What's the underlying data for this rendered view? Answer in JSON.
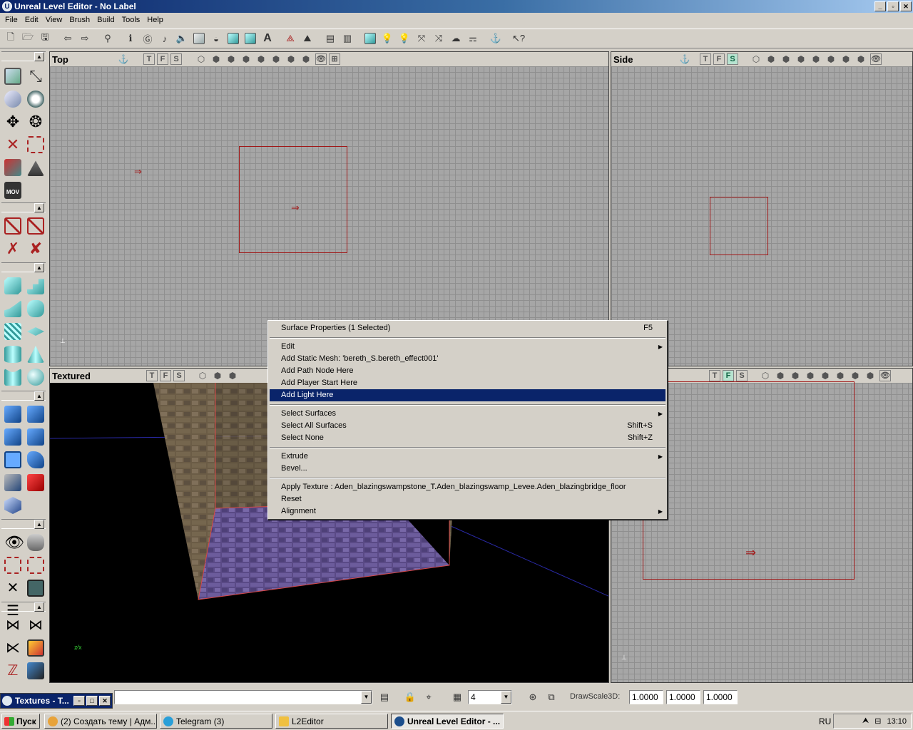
{
  "window": {
    "title": "Unreal Level Editor - No Label",
    "controls": [
      "_",
      "▫",
      "✕"
    ]
  },
  "menu": [
    "File",
    "Edit",
    "View",
    "Brush",
    "Build",
    "Tools",
    "Help"
  ],
  "viewports": {
    "top": {
      "title": "Top",
      "btns": [
        "T",
        "F",
        "S"
      ]
    },
    "side": {
      "title": "Side",
      "btns": [
        "T",
        "F",
        "S"
      ]
    },
    "textured": {
      "title": "Textured",
      "btns": [
        "T",
        "F",
        "S"
      ]
    },
    "front": {
      "btns": [
        "T",
        "F",
        "S"
      ]
    }
  },
  "context_menu": {
    "items": [
      {
        "label": "Surface Properties (1 Selected)",
        "shortcut": "F5"
      },
      {
        "sep": true
      },
      {
        "label": "Edit",
        "submenu": true
      },
      {
        "label": "Add Static Mesh: 'bereth_S.bereth_effect001'"
      },
      {
        "label": "Add Path Node Here"
      },
      {
        "label": "Add Player Start Here"
      },
      {
        "label": "Add Light Here",
        "highlighted": true
      },
      {
        "sep": true
      },
      {
        "label": "Select Surfaces",
        "submenu": true
      },
      {
        "label": "Select All Surfaces",
        "shortcut": "Shift+S"
      },
      {
        "label": "Select None",
        "shortcut": "Shift+Z"
      },
      {
        "sep": true
      },
      {
        "label": "Extrude",
        "submenu": true
      },
      {
        "label": "Bevel..."
      },
      {
        "sep": true
      },
      {
        "label": "Apply Texture : Aden_blazingswampstone_T.Aden_blazingswamp_Levee.Aden_blazingbridge_floor"
      },
      {
        "label": "Reset"
      },
      {
        "label": "Alignment",
        "submenu": true
      }
    ]
  },
  "status": {
    "texture_window": "Textures - T...",
    "grid_size": "4",
    "drawscale_label": "DrawScale3D:",
    "drawscale": [
      "1.0000",
      "1.0000",
      "1.0000"
    ]
  },
  "taskbar": {
    "start": "Пуск",
    "tasks": [
      {
        "label": "(2) Создать тему | Адм...",
        "color": "#e8a33a"
      },
      {
        "label": "Telegram (3)",
        "color": "#2a9fd8"
      },
      {
        "label": "L2Editor",
        "color": "#f0c040"
      },
      {
        "label": "Unreal Level Editor - ...",
        "color": "#1c4e8c",
        "active": true
      }
    ],
    "lang": "RU",
    "clock": "13:10"
  },
  "colors": {
    "brush": "#a01818",
    "highlight": "#0a246a",
    "titlebar": "#0a246a"
  }
}
